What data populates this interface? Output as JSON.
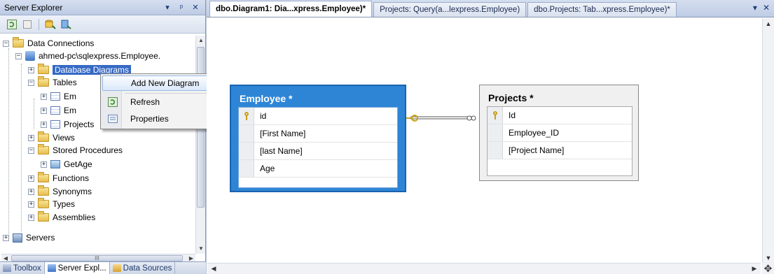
{
  "server_explorer": {
    "title": "Server Explorer",
    "title_buttons": [
      "▾",
      "ᵖ",
      "✕"
    ],
    "tree": {
      "data_connections": "Data Connections",
      "connection": "ahmed-pc\\sqlexpress.Employee.",
      "database_diagrams": "Database Diagrams",
      "tables": "Tables",
      "table_items": [
        "Em",
        "Em",
        "Projects"
      ],
      "views": "Views",
      "stored_procedures": "Stored Procedures",
      "get_age": "GetAge",
      "functions": "Functions",
      "synonyms": "Synonyms",
      "types": "Types",
      "assemblies": "Assemblies",
      "servers": "Servers"
    },
    "hscroll_grip": "III"
  },
  "context_menu": {
    "items": [
      "Add New Diagram",
      "Refresh",
      "Properties"
    ]
  },
  "bottom_tabs": [
    "Toolbox",
    "Server Expl...",
    "Data Sources"
  ],
  "document": {
    "tabs": [
      "dbo.Diagram1: Dia...xpress.Employee)*",
      "Projects: Query(a...lexpress.Employee)",
      "dbo.Projects: Tab...xpress.Employee)*"
    ],
    "tab_controls": [
      "▾",
      "✕"
    ]
  },
  "diagram": {
    "employee": {
      "title": "Employee *",
      "columns": [
        "id",
        "[First Name]",
        "[last Name]",
        "Age"
      ]
    },
    "projects": {
      "title": "Projects *",
      "columns": [
        "Id",
        "Employee_ID",
        "[Project Name]"
      ]
    }
  },
  "colors": {
    "selected_table": "#2e85d6",
    "selection": "#3569c5",
    "key": "#c9a017"
  }
}
